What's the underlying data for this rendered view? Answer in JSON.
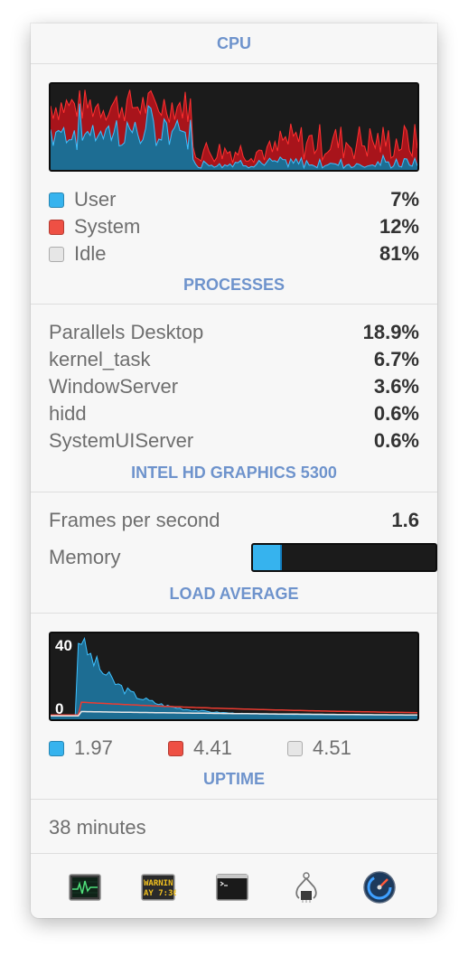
{
  "cpu": {
    "header": "CPU",
    "legend": [
      {
        "label": "User",
        "value": "7%",
        "color": "#36b3ee"
      },
      {
        "label": "System",
        "value": "12%",
        "color": "#ee5044"
      },
      {
        "label": "Idle",
        "value": "81%",
        "color": "#e6e6e6"
      }
    ]
  },
  "processes": {
    "header": "PROCESSES",
    "items": [
      {
        "name": "Parallels Desktop",
        "value": "18.9%"
      },
      {
        "name": "kernel_task",
        "value": "6.7%"
      },
      {
        "name": "WindowServer",
        "value": "3.6%"
      },
      {
        "name": "hidd",
        "value": "0.6%"
      },
      {
        "name": "SystemUIServer",
        "value": "0.6%"
      }
    ]
  },
  "gpu": {
    "header": "INTEL HD GRAPHICS 5300",
    "fps_label": "Frames per second",
    "fps_value": "1.6",
    "memory_label": "Memory",
    "memory_fraction": 0.16
  },
  "load": {
    "header": "LOAD AVERAGE",
    "axis_max": "40",
    "axis_min": "0",
    "legend": [
      {
        "value": "1.97",
        "color": "#36b3ee"
      },
      {
        "value": "4.41",
        "color": "#ee5044"
      },
      {
        "value": "4.51",
        "color": "#e6e6e6"
      }
    ]
  },
  "uptime": {
    "header": "UPTIME",
    "value": "38 minutes"
  },
  "toolbar": {
    "items": [
      "activity-monitor-icon",
      "console-icon",
      "terminal-icon",
      "system-information-icon",
      "disk-utility-icon"
    ],
    "console_text": [
      "WARNIN",
      "AY 7:36"
    ]
  }
}
